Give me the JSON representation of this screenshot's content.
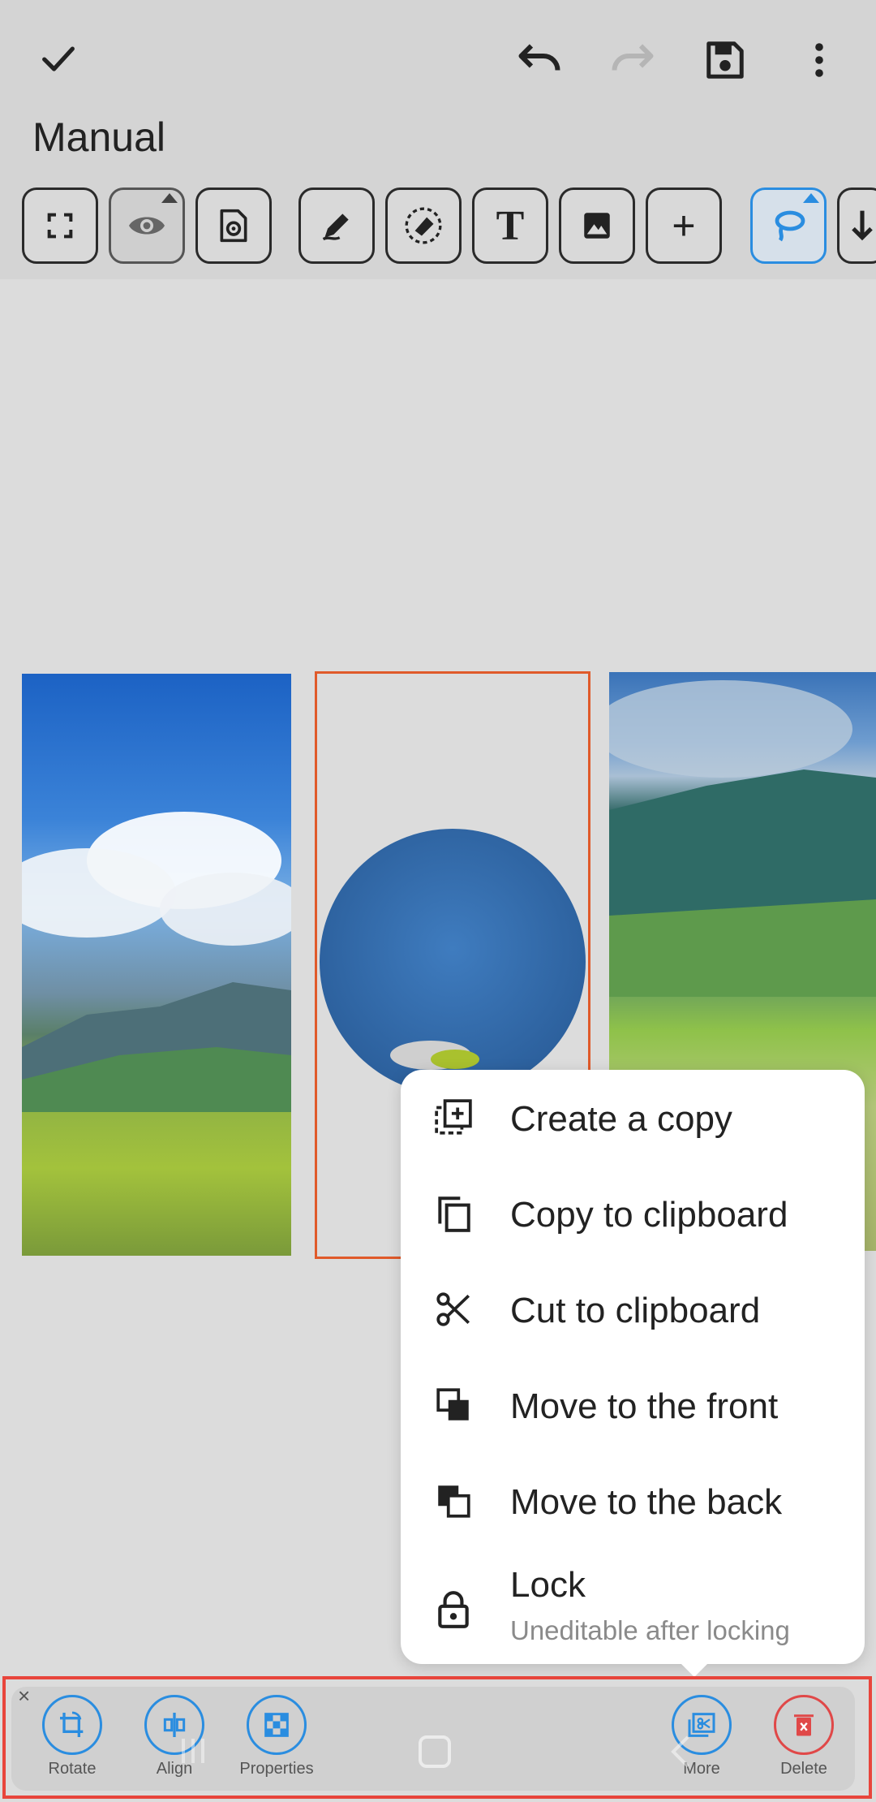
{
  "header": {
    "title": "Manual",
    "icons": [
      "check-icon",
      "undo-icon",
      "redo-icon",
      "save-icon",
      "more-vert-icon"
    ]
  },
  "toolbar": {
    "tools": [
      "fullscreen-icon",
      "eye-icon",
      "settings-page-icon",
      "pen-icon",
      "eraser-icon",
      "text-icon",
      "image-icon",
      "plus-icon",
      "lasso-icon",
      "arrow-down-icon"
    ],
    "text_tool_glyph": "T",
    "plus_glyph": "+"
  },
  "context_menu": {
    "items": [
      {
        "label": "Create a copy",
        "icon": "create-copy-icon"
      },
      {
        "label": "Copy to clipboard",
        "icon": "copy-icon"
      },
      {
        "label": "Cut to clipboard",
        "icon": "scissors-icon"
      },
      {
        "label": "Move to the front",
        "icon": "bring-front-icon"
      },
      {
        "label": "Move to the back",
        "icon": "send-back-icon"
      },
      {
        "label": "Lock",
        "sublabel": "Uneditable after locking",
        "icon": "lock-icon"
      }
    ]
  },
  "bottom_actions": {
    "rotate": "Rotate",
    "align": "Align",
    "properties": "Properties",
    "more": "More",
    "delete": "Delete",
    "close_glyph": "×"
  },
  "colors": {
    "accent": "#2a8de0",
    "selection": "#e05a2a",
    "danger": "#e04848"
  }
}
